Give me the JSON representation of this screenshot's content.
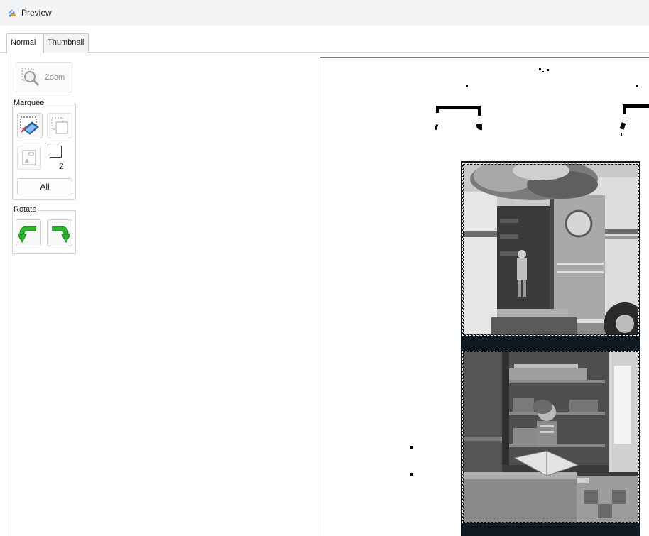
{
  "window": {
    "title": "Preview",
    "icon": "preview-app-icon"
  },
  "tabs": [
    {
      "label": "Normal",
      "active": true
    },
    {
      "label": "Thumbnail",
      "active": false
    }
  ],
  "toolbar": {
    "zoom_label": "Zoom",
    "marquee_label": "Marquee",
    "marquee_count": "2",
    "all_label": "All",
    "rotate_label": "Rotate"
  },
  "colors": {
    "rotate_arrow": "#2db52d",
    "selection_border": "#ffffff",
    "film_base": "#0f1720"
  }
}
